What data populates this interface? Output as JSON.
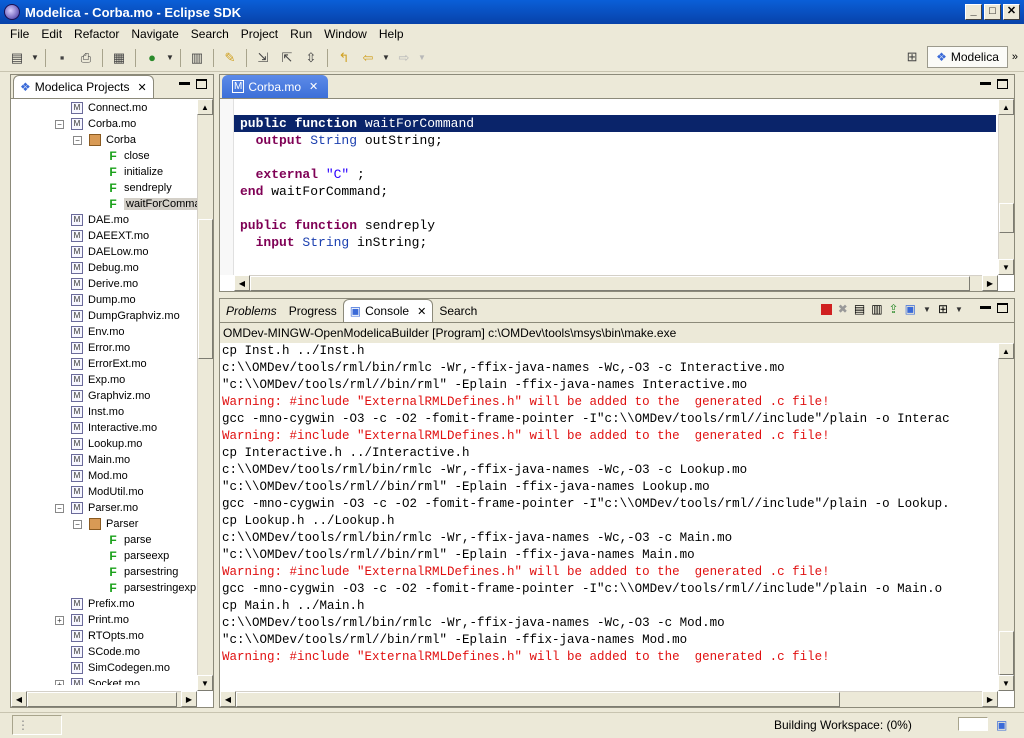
{
  "window": {
    "title": "Modelica - Corba.mo - Eclipse SDK"
  },
  "menu": [
    "File",
    "Edit",
    "Refactor",
    "Navigate",
    "Search",
    "Project",
    "Run",
    "Window",
    "Help"
  ],
  "perspective": {
    "label": "Modelica"
  },
  "projects": {
    "title": "Modelica Projects",
    "items": [
      {
        "label": "Connect.mo",
        "icon": "module-icon",
        "indent": 0
      },
      {
        "label": "Corba.mo",
        "icon": "module-icon",
        "indent": 0,
        "exp": "−"
      },
      {
        "label": "Corba",
        "icon": "package-icon",
        "indent": 1,
        "exp": "−"
      },
      {
        "label": "close",
        "icon": "function-icon",
        "indent": 2
      },
      {
        "label": "initialize",
        "icon": "function-icon",
        "indent": 2
      },
      {
        "label": "sendreply",
        "icon": "function-icon",
        "indent": 2
      },
      {
        "label": "waitForCommand",
        "icon": "function-icon",
        "indent": 2,
        "selected": true
      },
      {
        "label": "DAE.mo",
        "icon": "module-icon",
        "indent": 0
      },
      {
        "label": "DAEEXT.mo",
        "icon": "module-icon",
        "indent": 0
      },
      {
        "label": "DAELow.mo",
        "icon": "module-icon",
        "indent": 0
      },
      {
        "label": "Debug.mo",
        "icon": "module-icon",
        "indent": 0
      },
      {
        "label": "Derive.mo",
        "icon": "module-icon",
        "indent": 0
      },
      {
        "label": "Dump.mo",
        "icon": "module-icon",
        "indent": 0
      },
      {
        "label": "DumpGraphviz.mo",
        "icon": "module-icon",
        "indent": 0
      },
      {
        "label": "Env.mo",
        "icon": "module-icon",
        "indent": 0
      },
      {
        "label": "Error.mo",
        "icon": "module-icon",
        "indent": 0
      },
      {
        "label": "ErrorExt.mo",
        "icon": "module-icon",
        "indent": 0
      },
      {
        "label": "Exp.mo",
        "icon": "module-icon",
        "indent": 0
      },
      {
        "label": "Graphviz.mo",
        "icon": "module-icon",
        "indent": 0
      },
      {
        "label": "Inst.mo",
        "icon": "module-icon",
        "indent": 0
      },
      {
        "label": "Interactive.mo",
        "icon": "module-icon",
        "indent": 0
      },
      {
        "label": "Lookup.mo",
        "icon": "module-icon",
        "indent": 0
      },
      {
        "label": "Main.mo",
        "icon": "module-icon",
        "indent": 0
      },
      {
        "label": "Mod.mo",
        "icon": "module-icon",
        "indent": 0
      },
      {
        "label": "ModUtil.mo",
        "icon": "module-icon",
        "indent": 0
      },
      {
        "label": "Parser.mo",
        "icon": "module-icon",
        "indent": 0,
        "exp": "−"
      },
      {
        "label": "Parser",
        "icon": "package-icon",
        "indent": 1,
        "exp": "−"
      },
      {
        "label": "parse",
        "icon": "function-icon",
        "indent": 2
      },
      {
        "label": "parseexp",
        "icon": "function-icon",
        "indent": 2
      },
      {
        "label": "parsestring",
        "icon": "function-icon",
        "indent": 2
      },
      {
        "label": "parsestringexp",
        "icon": "function-icon",
        "indent": 2
      },
      {
        "label": "Prefix.mo",
        "icon": "module-icon",
        "indent": 0
      },
      {
        "label": "Print.mo",
        "icon": "module-icon",
        "indent": 0,
        "exp": "+"
      },
      {
        "label": "RTOpts.mo",
        "icon": "module-icon",
        "indent": 0
      },
      {
        "label": "SCode.mo",
        "icon": "module-icon",
        "indent": 0
      },
      {
        "label": "SimCodegen.mo",
        "icon": "module-icon",
        "indent": 0
      },
      {
        "label": "Socket.mo",
        "icon": "module-icon",
        "indent": 0,
        "exp": "+"
      }
    ]
  },
  "editor": {
    "tab": "Corba.mo",
    "lines": [
      [
        {
          "t": "public function ",
          "c": "kw"
        },
        {
          "t": "waitForCommand",
          "c": ""
        }
      ],
      [
        {
          "t": "  output ",
          "c": "kw"
        },
        {
          "t": "String",
          "c": "ty"
        },
        {
          "t": " outString;",
          "c": ""
        }
      ],
      [],
      [
        {
          "t": "  external ",
          "c": "kw"
        },
        {
          "t": "\"C\"",
          "c": "st"
        },
        {
          "t": " ;",
          "c": ""
        }
      ],
      [
        {
          "t": "end ",
          "c": "kw"
        },
        {
          "t": "waitForCommand;",
          "c": ""
        }
      ],
      [],
      [
        {
          "t": "public function ",
          "c": "kw"
        },
        {
          "t": "sendreply",
          "c": ""
        }
      ],
      [
        {
          "t": "  input ",
          "c": "kw"
        },
        {
          "t": "String",
          "c": "ty"
        },
        {
          "t": " inString;",
          "c": ""
        }
      ]
    ]
  },
  "bottom": {
    "tabs": [
      "Problems",
      "Progress",
      "Console",
      "Search"
    ],
    "header": "OMDev-MINGW-OpenModelicaBuilder [Program] c:\\OMDev\\tools\\msys\\bin\\make.exe",
    "lines": [
      {
        "t": "cp Inst.h ../Inst.h",
        "w": false
      },
      {
        "t": "c:\\\\OMDev/tools/rml/bin/rmlc -Wr,-ffix-java-names -Wc,-O3 -c Interactive.mo",
        "w": false
      },
      {
        "t": "\"c:\\\\OMDev/tools/rml//bin/rml\" -Eplain -ffix-java-names Interactive.mo",
        "w": false
      },
      {
        "t": "Warning: #include \"ExternalRMLDefines.h\" will be added to the  generated .c file!",
        "w": true
      },
      {
        "t": "gcc -mno-cygwin -O3 -c -O2 -fomit-frame-pointer -I\"c:\\\\OMDev/tools/rml//include\"/plain -o Interac",
        "w": false
      },
      {
        "t": "Warning: #include \"ExternalRMLDefines.h\" will be added to the  generated .c file!",
        "w": true
      },
      {
        "t": "cp Interactive.h ../Interactive.h",
        "w": false
      },
      {
        "t": "c:\\\\OMDev/tools/rml/bin/rmlc -Wr,-ffix-java-names -Wc,-O3 -c Lookup.mo",
        "w": false
      },
      {
        "t": "\"c:\\\\OMDev/tools/rml//bin/rml\" -Eplain -ffix-java-names Lookup.mo",
        "w": false
      },
      {
        "t": "gcc -mno-cygwin -O3 -c -O2 -fomit-frame-pointer -I\"c:\\\\OMDev/tools/rml//include\"/plain -o Lookup.",
        "w": false
      },
      {
        "t": "cp Lookup.h ../Lookup.h",
        "w": false
      },
      {
        "t": "c:\\\\OMDev/tools/rml/bin/rmlc -Wr,-ffix-java-names -Wc,-O3 -c Main.mo",
        "w": false
      },
      {
        "t": "\"c:\\\\OMDev/tools/rml//bin/rml\" -Eplain -ffix-java-names Main.mo",
        "w": false
      },
      {
        "t": "Warning: #include \"ExternalRMLDefines.h\" will be added to the  generated .c file!",
        "w": true
      },
      {
        "t": "gcc -mno-cygwin -O3 -c -O2 -fomit-frame-pointer -I\"c:\\\\OMDev/tools/rml//include\"/plain -o Main.o",
        "w": false
      },
      {
        "t": "cp Main.h ../Main.h",
        "w": false
      },
      {
        "t": "c:\\\\OMDev/tools/rml/bin/rmlc -Wr,-ffix-java-names -Wc,-O3 -c Mod.mo",
        "w": false
      },
      {
        "t": "\"c:\\\\OMDev/tools/rml//bin/rml\" -Eplain -ffix-java-names Mod.mo",
        "w": false
      },
      {
        "t": "Warning: #include \"ExternalRMLDefines.h\" will be added to the  generated .c file!",
        "w": true
      }
    ]
  },
  "status": {
    "text": "Building Workspace: (0%)",
    "progress": 0
  }
}
